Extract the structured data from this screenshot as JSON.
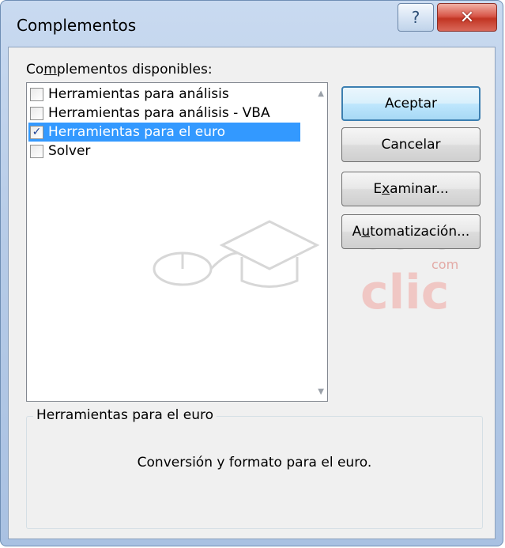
{
  "window": {
    "title": "Complementos",
    "help_label": "?",
    "close_label": "✕"
  },
  "addins": {
    "label_prefix": "Co",
    "label_underline": "m",
    "label_suffix": "plementos disponibles:",
    "items": [
      {
        "label": "Herramientas para análisis",
        "checked": false,
        "selected": false
      },
      {
        "label": "Herramientas para análisis - VBA",
        "checked": false,
        "selected": false
      },
      {
        "label": "Herramientas para el euro",
        "checked": true,
        "selected": true
      },
      {
        "label": "Solver",
        "checked": false,
        "selected": false
      }
    ]
  },
  "buttons": {
    "accept": "Aceptar",
    "cancel": "Cancelar",
    "browse_prefix": "E",
    "browse_underline": "x",
    "browse_suffix": "aminar...",
    "automation_prefix": "A",
    "automation_underline": "u",
    "automation_suffix": "tomatización..."
  },
  "details": {
    "title": "Herramientas para el euro",
    "description": "Conversión y formato para el euro."
  },
  "watermark": {
    "text_top": "aula",
    "text_com": "com",
    "text_bottom": "clic"
  }
}
